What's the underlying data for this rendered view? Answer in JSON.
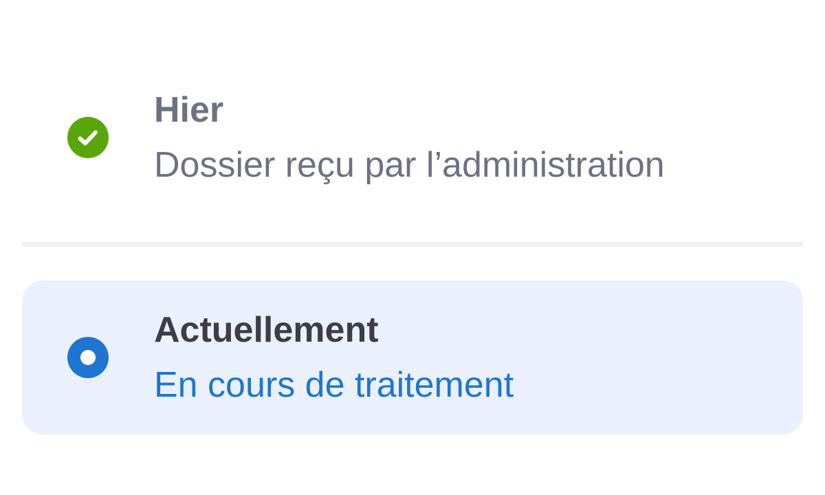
{
  "timeline": {
    "steps": [
      {
        "title": "Hier",
        "subtitle": "Dossier reçu par l’administration",
        "status": "completed",
        "icon": "check-circle-icon"
      },
      {
        "title": "Actuellement",
        "subtitle": "En cours de traitement",
        "status": "current",
        "icon": "radio-dot-icon"
      }
    ]
  },
  "colors": {
    "completed": "#58a60a",
    "current": "#1f75cf",
    "muted_text": "#6f7183",
    "strong_text": "#3c3d45",
    "current_background": "#eaf1fc",
    "divider": "#f1f1f3"
  }
}
